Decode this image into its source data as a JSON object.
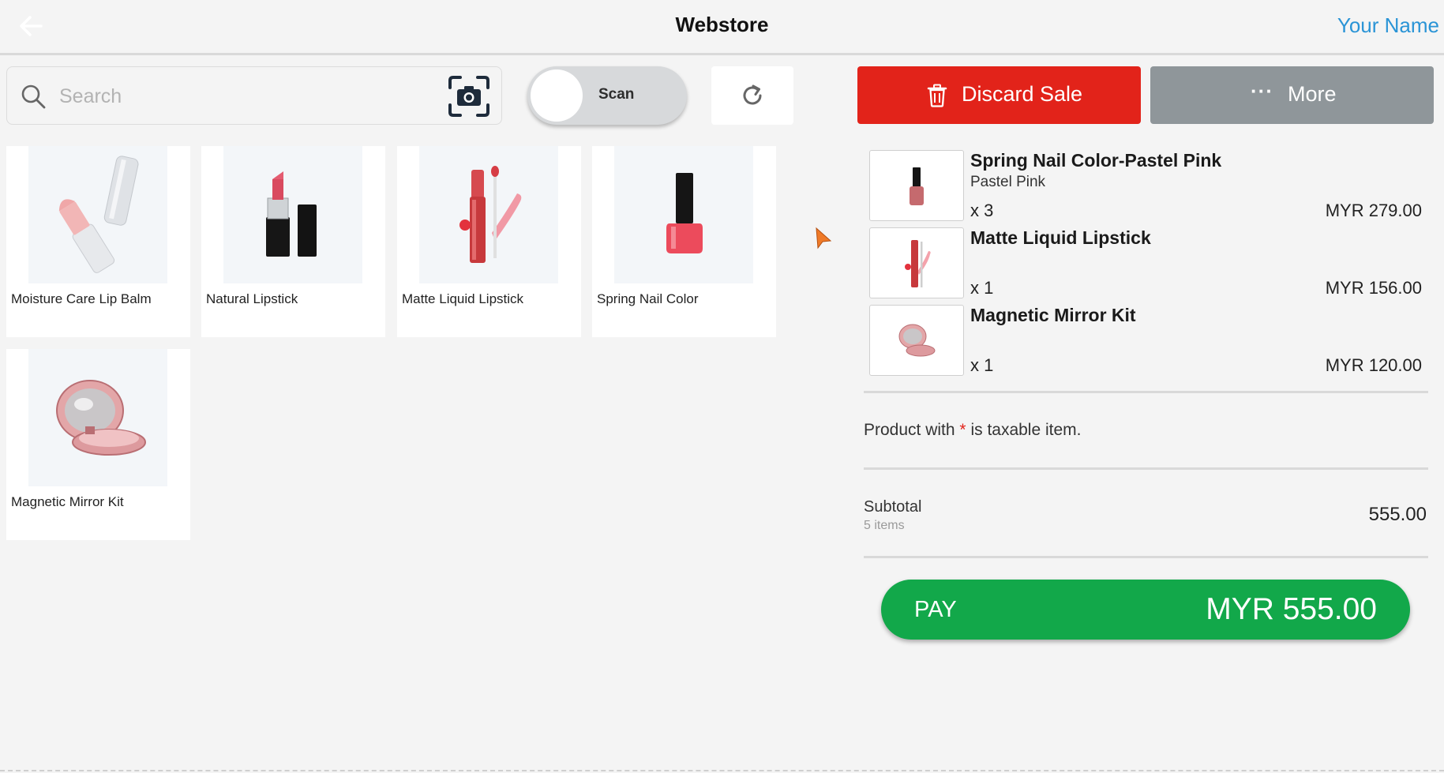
{
  "header": {
    "title": "Webstore",
    "user_name": "Your Name"
  },
  "search": {
    "placeholder": "Search"
  },
  "toolbar": {
    "scan_label": "Scan",
    "discard_label": "Discard Sale",
    "more_dots": "···",
    "more_label": "More"
  },
  "products": [
    {
      "name": "Moisture Care Lip Balm"
    },
    {
      "name": "Natural Lipstick"
    },
    {
      "name": "Matte Liquid Lipstick"
    },
    {
      "name": "Spring Nail Color"
    },
    {
      "name": "Magnetic Mirror Kit"
    }
  ],
  "cart": {
    "items": [
      {
        "name": "Spring Nail Color-Pastel Pink",
        "variant": "Pastel Pink",
        "qty": "x 3",
        "price": "MYR 279.00"
      },
      {
        "name": "Matte Liquid Lipstick",
        "variant": "",
        "qty": "x 1",
        "price": "MYR 156.00"
      },
      {
        "name": "Magnetic Mirror Kit",
        "variant": "",
        "qty": "x 1",
        "price": "MYR 120.00"
      }
    ],
    "tax_note_prefix": "Product with",
    "tax_note_star": "*",
    "tax_note_suffix": "is taxable item.",
    "subtotal_label": "Subtotal",
    "subtotal_count": "5 items",
    "subtotal_value": "555.00",
    "pay_label": "PAY",
    "pay_amount": "MYR 555.00"
  },
  "colors": {
    "discard": "#e2231a",
    "more": "#8f969a",
    "pay": "#12a84a",
    "link": "#2a94d6"
  }
}
